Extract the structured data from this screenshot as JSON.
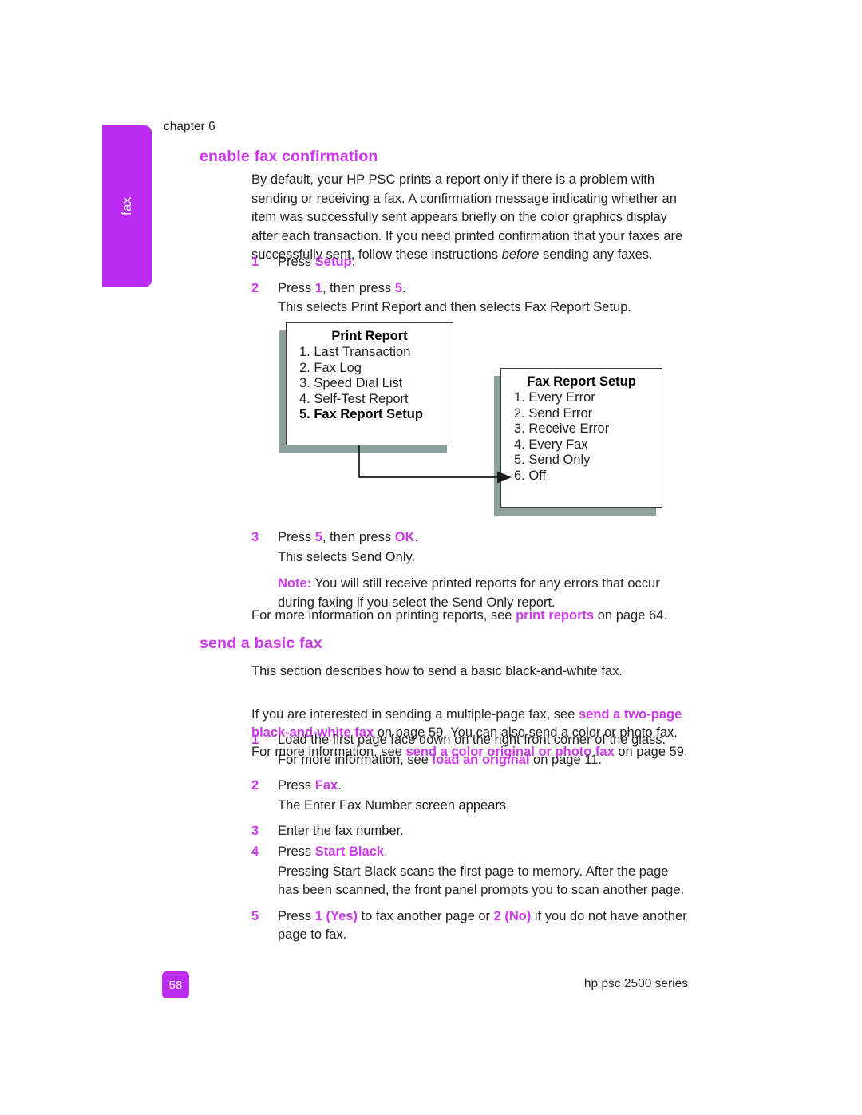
{
  "document": {
    "chapter_label": "chapter 6",
    "side_tab_label": "fax",
    "page_number": "58",
    "footer_right": "hp psc 2500 series",
    "accent_color": "#cd38ee",
    "tab_color": "#bb2bf2",
    "shadow_color": "#8ca09c"
  },
  "section_enable": {
    "heading": "enable fax confirmation",
    "intro_1": "By default, your HP PSC prints a report only if there is a problem with sending or receiving a fax. A confirmation message indicating whether an item was successfully sent appears briefly on the color graphics display after each transaction. If you need printed confirmation that your faxes are successfully sent, follow these instructions ",
    "intro_1_italic": "before",
    "intro_1_tail": " sending any faxes.",
    "step1_num": "1",
    "step1_pre": "Press ",
    "step1_key": "Setup",
    "step1_post": ".",
    "step2_num": "2",
    "step2_pre": "Press ",
    "step2_key_a": "1",
    "step2_mid": ", then press ",
    "step2_key_b": "5",
    "step2_post": ".",
    "step2_sub": "This selects Print Report and then selects Fax Report Setup.",
    "step3_num": "3",
    "step3_pre": "Press ",
    "step3_key_a": "5",
    "step3_mid": ", then press ",
    "step3_key_b": "OK",
    "step3_post": ".",
    "step3_sub": "This selects Send Only.",
    "note_label": "Note:",
    "note_text": " You will still receive printed reports for any errors that occur during faxing if you select the Send Only report.",
    "more_info_pre": "For more information on printing reports, see ",
    "more_info_link": "print reports",
    "more_info_post": " on page 64."
  },
  "diagram": {
    "box_print_report": {
      "title": "Print Report",
      "items": [
        "1. Last Transaction",
        "2. Fax Log",
        "3. Speed Dial List",
        "4. Self-Test Report",
        "5. Fax Report Setup"
      ],
      "highlighted_index": 4
    },
    "box_fax_report_setup": {
      "title": "Fax Report Setup",
      "items": [
        "1. Every Error",
        "2. Send Error",
        "3. Receive Error",
        "4. Every Fax",
        "5. Send Only",
        "6. Off"
      ]
    }
  },
  "section_send": {
    "heading": "send a basic fax",
    "para_1": "This section describes how to send a basic black-and-white fax.",
    "para_2_pre": "If you are interested in sending a multiple-page fax, see ",
    "para_2_link_a": "send a two-page black-and-white fax",
    "para_2_mid": " on page 59. You can also send a color or photo fax. For more information, see ",
    "para_2_link_b": "send a color original or photo fax",
    "para_2_post": " on page 59.",
    "step1_num": "1",
    "step1_text": "Load the first page face down on the right front corner of the glass.",
    "step1_sub_pre": "For more information, see ",
    "step1_sub_link": "load an original",
    "step1_sub_post": " on page 11.",
    "step2_num": "2",
    "step2_pre": "Press ",
    "step2_key": "Fax",
    "step2_post": ".",
    "step2_sub": "The Enter Fax Number screen appears.",
    "step3_num": "3",
    "step3_text": "Enter the fax number.",
    "step4_num": "4",
    "step4_pre": "Press ",
    "step4_key": "Start Black",
    "step4_post": ".",
    "step4_sub": "Pressing Start Black scans the first page to memory. After the page has been scanned, the front panel prompts you to scan another page.",
    "step5_num": "5",
    "step5_pre": "Press ",
    "step5_key_a": "1 (Yes)",
    "step5_mid": " to fax another page or ",
    "step5_key_b": "2 (No)",
    "step5_post": " if you do not have another page to fax."
  }
}
